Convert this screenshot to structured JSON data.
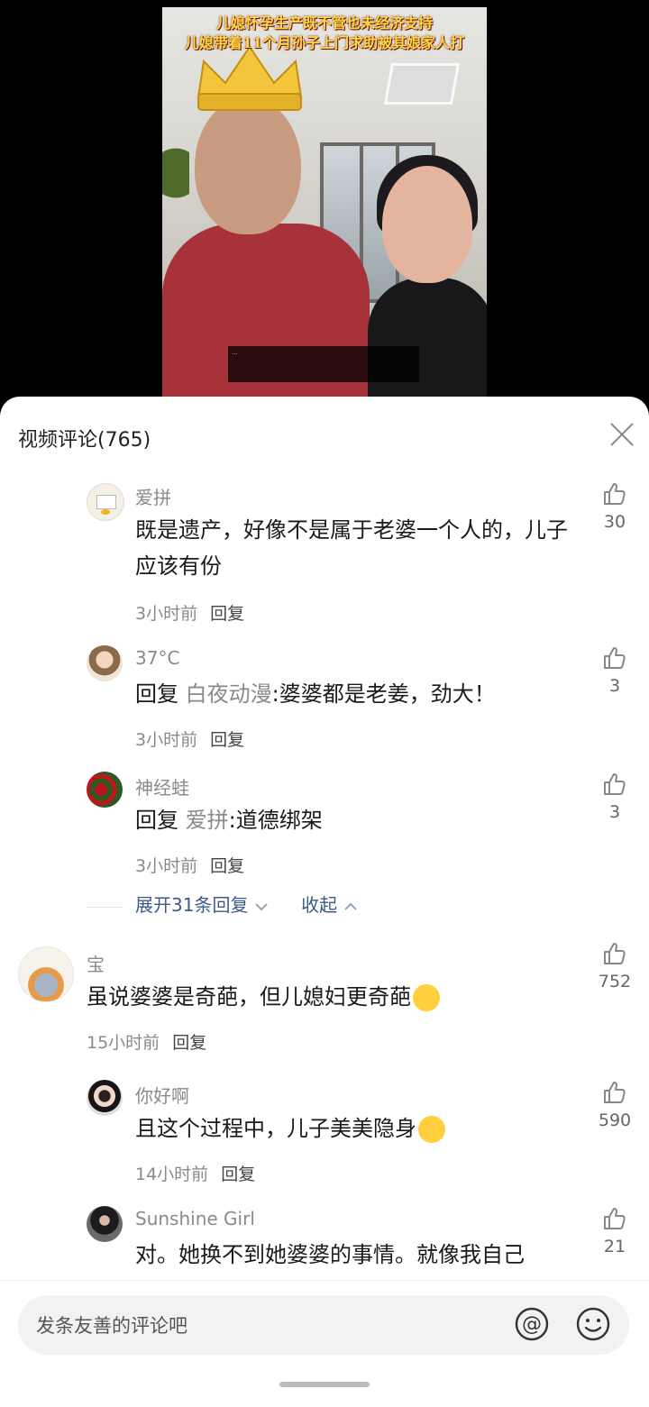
{
  "video": {
    "caption_line1": "儿媳怀孕生产既不管也未经济支持",
    "caption_line2": "儿媳带着11个月孙子上门求助被其娘家人打",
    "notice_text": "…"
  },
  "sheet": {
    "title": "视频评论(765)"
  },
  "comments": [
    {
      "user": "爱拼",
      "text": "既是遗产，好像不是属于老婆一个人的，儿子应该有份",
      "time": "3小时前",
      "reply_label": "回复",
      "likes": "30"
    },
    {
      "user": "37°C",
      "prefix": "回复",
      "ref_user": "白夜动漫",
      "text": ":婆婆都是老姜，劲大！",
      "time": "3小时前",
      "reply_label": "回复",
      "likes": "3"
    },
    {
      "user": "神经蛙",
      "prefix": "回复",
      "ref_user": "爱拼",
      "text": ":道德绑架",
      "time": "3小时前",
      "reply_label": "回复",
      "likes": "3"
    },
    {
      "user": "宝",
      "text": "虽说婆婆是奇葩，但儿媳妇更奇葩",
      "time": "15小时前",
      "reply_label": "回复",
      "likes": "752"
    },
    {
      "user": "你好啊",
      "text": "且这个过程中，儿子美美隐身",
      "time": "14小时前",
      "reply_label": "回复",
      "likes": "590"
    },
    {
      "user": "Sunshine Girl",
      "text": "对。她换不到她婆婆的事情。就像我自己",
      "likes": "21"
    }
  ],
  "expand": {
    "more_label": "展开31条回复",
    "collapse_label": "收起"
  },
  "input": {
    "placeholder": "发条友善的评论吧"
  },
  "icons": {
    "like": "thumbs-up-icon",
    "close": "close-icon",
    "at": "at-icon",
    "emoji": "smile-icon"
  }
}
